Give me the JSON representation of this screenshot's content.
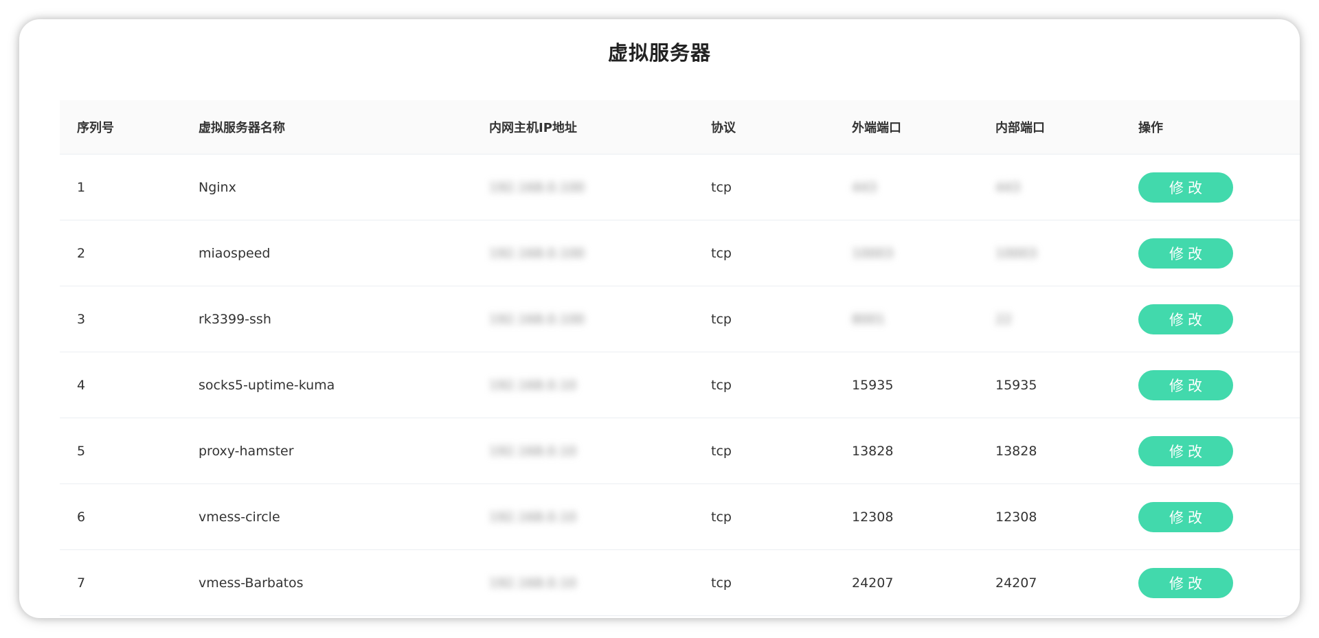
{
  "page": {
    "title": "虚拟服务器"
  },
  "table": {
    "headers": [
      "序列号",
      "虚拟服务器名称",
      "内网主机IP地址",
      "协议",
      "外端端口",
      "内部端口",
      "操作"
    ],
    "rows": [
      {
        "index": "1",
        "name": "Nginx",
        "ip": "192.168.0.100",
        "protocol": "tcp",
        "external_port": "443",
        "internal_port": "443",
        "action": "修改"
      },
      {
        "index": "2",
        "name": "miaospeed",
        "ip": "192.168.0.100",
        "protocol": "tcp",
        "external_port": "10003",
        "internal_port": "10003",
        "action": "修改"
      },
      {
        "index": "3",
        "name": "rk3399-ssh",
        "ip": "192.168.0.100",
        "protocol": "tcp",
        "external_port": "8001",
        "internal_port": "22",
        "action": "修改"
      },
      {
        "index": "4",
        "name": "socks5-uptime-kuma",
        "ip": "192.168.0.10",
        "protocol": "tcp",
        "external_port": "15935",
        "internal_port": "15935",
        "action": "修改"
      },
      {
        "index": "5",
        "name": "proxy-hamster",
        "ip": "192.168.0.10",
        "protocol": "tcp",
        "external_port": "13828",
        "internal_port": "13828",
        "action": "修改"
      },
      {
        "index": "6",
        "name": "vmess-circle",
        "ip": "192.168.0.10",
        "protocol": "tcp",
        "external_port": "12308",
        "internal_port": "12308",
        "action": "修改"
      },
      {
        "index": "7",
        "name": "vmess-Barbatos",
        "ip": "192.168.0.10",
        "protocol": "tcp",
        "external_port": "24207",
        "internal_port": "24207",
        "action": "修改"
      }
    ]
  },
  "colors": {
    "accent": "#42d9ac",
    "header_bg": "#fafafa",
    "border": "#ebeef2"
  }
}
